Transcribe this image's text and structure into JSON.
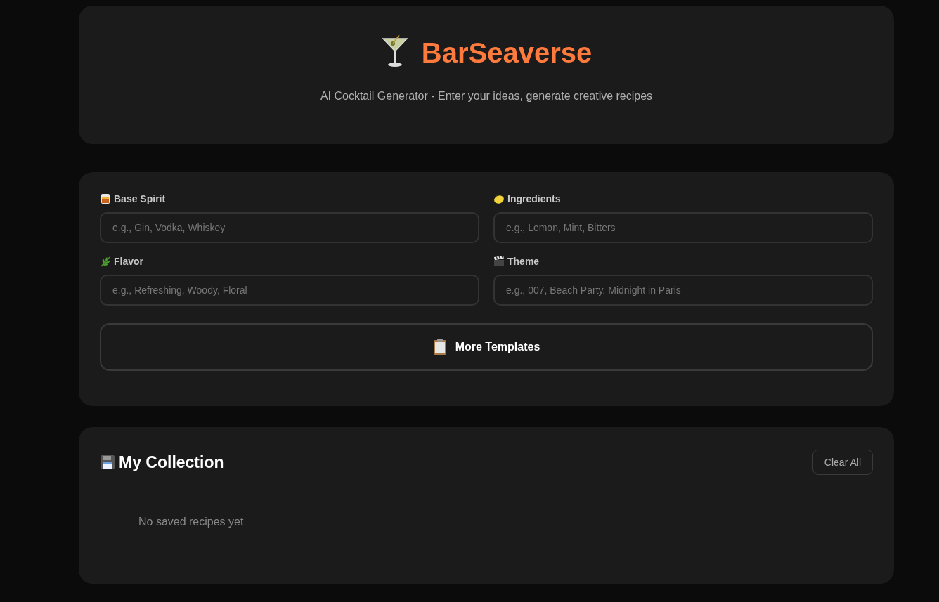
{
  "header": {
    "title": "BarSeaverse",
    "subtitle": "AI Cocktail Generator - Enter your ideas, generate creative recipes"
  },
  "fields": [
    {
      "label": "Base Spirit",
      "placeholder": "e.g., Gin, Vodka, Whiskey"
    },
    {
      "label": "Ingredients",
      "placeholder": "e.g., Lemon, Mint, Bitters"
    },
    {
      "label": "Flavor",
      "placeholder": "e.g., Refreshing, Woody, Floral"
    },
    {
      "label": "Theme",
      "placeholder": "e.g., 007, Beach Party, Midnight in Paris"
    }
  ],
  "templates_button": "More Templates",
  "collection": {
    "title": "My Collection",
    "clear_button": "Clear All",
    "empty_text": "No saved recipes yet"
  }
}
